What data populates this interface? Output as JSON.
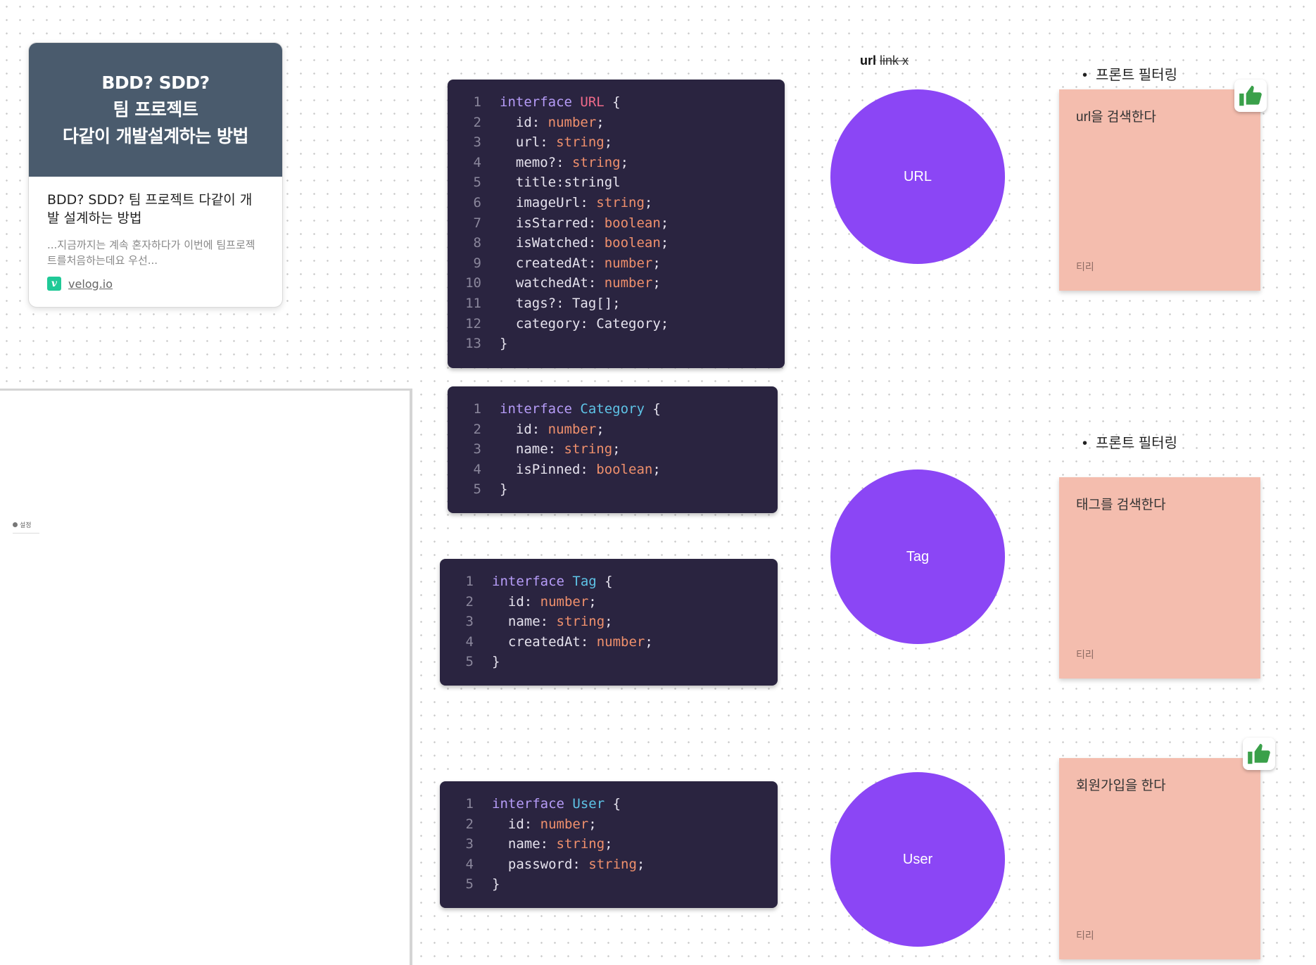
{
  "link_card": {
    "thumbnail_lines": [
      "BDD? SDD?",
      "팀 프로젝트",
      "다같이 개발설계하는 방법"
    ],
    "title": "BDD? SDD? 팀 프로젝트 다같이 개발 설계하는 방법",
    "description": "...지금까지는 계속 혼자하다가 이번에 팀프로젝트를처음하는데요 우선...",
    "source_icon": "v",
    "source": "velog.io"
  },
  "embed_panel": {
    "settings_label": "설정"
  },
  "url_label": {
    "bold": "url",
    "strike": "link x"
  },
  "code_blocks": [
    {
      "name": "URL",
      "lines": [
        [
          [
            "kw",
            "interface "
          ],
          [
            "name-url",
            "URL"
          ],
          [
            "pl",
            " {"
          ]
        ],
        [
          [
            "pl",
            "  id: "
          ],
          [
            "type",
            "number"
          ],
          [
            "pl",
            ";"
          ]
        ],
        [
          [
            "pl",
            "  url: "
          ],
          [
            "type",
            "string"
          ],
          [
            "pl",
            ";"
          ]
        ],
        [
          [
            "pl",
            "  memo?: "
          ],
          [
            "type",
            "string"
          ],
          [
            "pl",
            ";"
          ]
        ],
        [
          [
            "pl",
            "  title:stringl"
          ]
        ],
        [
          [
            "pl",
            "  imageUrl: "
          ],
          [
            "type",
            "string"
          ],
          [
            "pl",
            ";"
          ]
        ],
        [
          [
            "pl",
            "  isStarred: "
          ],
          [
            "type",
            "boolean"
          ],
          [
            "pl",
            ";"
          ]
        ],
        [
          [
            "pl",
            "  isWatched: "
          ],
          [
            "type",
            "boolean"
          ],
          [
            "pl",
            ";"
          ]
        ],
        [
          [
            "pl",
            "  createdAt: "
          ],
          [
            "type",
            "number"
          ],
          [
            "pl",
            ";"
          ]
        ],
        [
          [
            "pl",
            "  watchedAt: "
          ],
          [
            "type",
            "number"
          ],
          [
            "pl",
            ";"
          ]
        ],
        [
          [
            "pl",
            "  tags?: Tag[];"
          ]
        ],
        [
          [
            "pl",
            "  category: Category;"
          ]
        ],
        [
          [
            "pl",
            "}"
          ]
        ]
      ]
    },
    {
      "name": "Category",
      "lines": [
        [
          [
            "kw",
            "interface "
          ],
          [
            "name",
            "Category"
          ],
          [
            "pl",
            " {"
          ]
        ],
        [
          [
            "pl",
            "  id: "
          ],
          [
            "type",
            "number"
          ],
          [
            "pl",
            ";"
          ]
        ],
        [
          [
            "pl",
            "  name: "
          ],
          [
            "type",
            "string"
          ],
          [
            "pl",
            ";"
          ]
        ],
        [
          [
            "pl",
            "  isPinned: "
          ],
          [
            "type",
            "boolean"
          ],
          [
            "pl",
            ";"
          ]
        ],
        [
          [
            "pl",
            "}"
          ]
        ]
      ]
    },
    {
      "name": "Tag",
      "lines": [
        [
          [
            "kw",
            "interface "
          ],
          [
            "name",
            "Tag"
          ],
          [
            "pl",
            " {"
          ]
        ],
        [
          [
            "pl",
            "  id: "
          ],
          [
            "type",
            "number"
          ],
          [
            "pl",
            ";"
          ]
        ],
        [
          [
            "pl",
            "  name: "
          ],
          [
            "type",
            "string"
          ],
          [
            "pl",
            ";"
          ]
        ],
        [
          [
            "pl",
            "  createdAt: "
          ],
          [
            "type",
            "number"
          ],
          [
            "pl",
            ";"
          ]
        ],
        [
          [
            "pl",
            "}"
          ]
        ]
      ]
    },
    {
      "name": "User",
      "lines": [
        [
          [
            "kw",
            "interface "
          ],
          [
            "name",
            "User"
          ],
          [
            "pl",
            " {"
          ]
        ],
        [
          [
            "pl",
            "  id: "
          ],
          [
            "type",
            "number"
          ],
          [
            "pl",
            ";"
          ]
        ],
        [
          [
            "pl",
            "  name: "
          ],
          [
            "type",
            "string"
          ],
          [
            "pl",
            ";"
          ]
        ],
        [
          [
            "pl",
            "  password: "
          ],
          [
            "type",
            "string"
          ],
          [
            "pl",
            ";"
          ]
        ],
        [
          [
            "pl",
            "}"
          ]
        ]
      ]
    }
  ],
  "circles": [
    "URL",
    "Tag",
    "User"
  ],
  "circle_color": "#8b46f5",
  "sticky_color": "#f4bdae",
  "bullets": [
    "프론트 필터링",
    "프론트 필터링"
  ],
  "stickies": [
    {
      "text": "url을 검색한다",
      "author": "티리",
      "reaction": "thumbs-up-icon"
    },
    {
      "text": "태그를 검색한다",
      "author": "티리",
      "reaction": ""
    },
    {
      "text": "회원가입을 한다",
      "author": "티리",
      "reaction": "thumbs-up-icon"
    }
  ]
}
